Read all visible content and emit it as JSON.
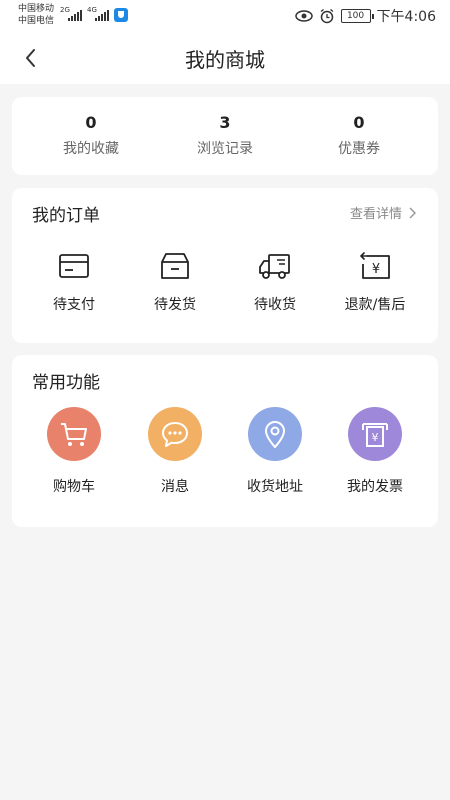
{
  "status_bar": {
    "carrier1": "中国移动",
    "carrier2": "中国电信",
    "net1": "2G",
    "net2": "4G",
    "battery": "100",
    "time": "下午4:06"
  },
  "header": {
    "title": "我的商城"
  },
  "stats": [
    {
      "value": "0",
      "label": "我的收藏"
    },
    {
      "value": "3",
      "label": "浏览记录"
    },
    {
      "value": "0",
      "label": "优惠券"
    }
  ],
  "orders": {
    "title": "我的订单",
    "more_label": "查看详情",
    "items": [
      {
        "label": "待支付",
        "icon": "card-icon"
      },
      {
        "label": "待发货",
        "icon": "box-icon"
      },
      {
        "label": "待收货",
        "icon": "truck-icon"
      },
      {
        "label": "退款/售后",
        "icon": "refund-icon"
      }
    ]
  },
  "functions": {
    "title": "常用功能",
    "items": [
      {
        "label": "购物车",
        "icon": "cart-icon",
        "color": "#e8826b"
      },
      {
        "label": "消息",
        "icon": "message-icon",
        "color": "#f1b063"
      },
      {
        "label": "收货地址",
        "icon": "location-icon",
        "color": "#8fa8e6"
      },
      {
        "label": "我的发票",
        "icon": "invoice-icon",
        "color": "#9d88d9"
      }
    ]
  }
}
